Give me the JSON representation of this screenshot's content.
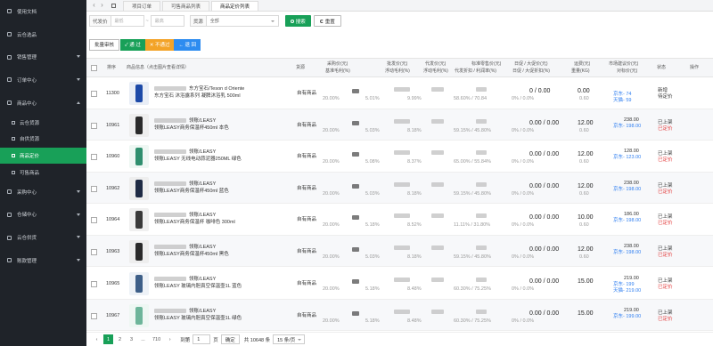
{
  "sidebar": {
    "items": [
      {
        "label": "使用文档",
        "icon": "doc-icon"
      },
      {
        "label": "云仓选品",
        "icon": "cloud-icon"
      },
      {
        "label": "销售管理",
        "icon": "sales-icon",
        "expandable": true
      },
      {
        "label": "订单中心",
        "icon": "order-icon",
        "expandable": true
      },
      {
        "label": "商品中心",
        "icon": "goods-icon",
        "expandable": true,
        "open": true
      },
      {
        "label": "云仓货源",
        "sub": true
      },
      {
        "label": "自供货源",
        "sub": true
      },
      {
        "label": "商品定价",
        "sub": true,
        "active": true
      },
      {
        "label": "可售商品",
        "sub": true
      },
      {
        "label": "采购中心",
        "icon": "purchase-icon",
        "expandable": true
      },
      {
        "label": "仓储中心",
        "icon": "warehouse-icon",
        "expandable": true
      },
      {
        "label": "云仓供货",
        "icon": "supply-icon",
        "expandable": true
      },
      {
        "label": "账款管理",
        "icon": "account-icon",
        "expandable": true
      }
    ]
  },
  "tabs": {
    "back": "‹",
    "forward": "›",
    "items": [
      {
        "label": "项目订单",
        "active": false
      },
      {
        "label": "可售商品列表",
        "active": false
      },
      {
        "label": "商品定价列表",
        "active": true
      }
    ]
  },
  "filters": {
    "code_label": "代发价",
    "min_placeholder": "最低",
    "sep": "~",
    "max_placeholder": "最高",
    "source_label": "货源",
    "source_value": "全部",
    "search_label": "搜索",
    "reset_label": "重置"
  },
  "actions": {
    "batch": "批量审核",
    "pass": "✓ 通 过",
    "reject": "✕ 不通过",
    "back": "← 退 回"
  },
  "table": {
    "headers": {
      "seq": "排序",
      "info": "商品信息（点击图片查看详情）",
      "source": "货源",
      "purchase": "采购价(元)",
      "purchase_sub": "基准毛利(%)",
      "wholesale": "批发价(元)",
      "wholesale_sub": "浮动毛利(%)",
      "dropship": "代发价(元)",
      "dropship_sub": "浮动毛利(%)",
      "retail": "标准零售价(元)",
      "retail_sub": "代发折扣 / 利润率(%)",
      "daily": "日促 / 大促价(元)",
      "daily_sub": "日促 / 大促折扣(%)",
      "freight": "运费(元)",
      "freight_sub": "重量(KG)",
      "market": "市场建议价(元)",
      "market_sub": "对标价(元)",
      "status": "状态",
      "ops": "操作"
    },
    "rows": [
      {
        "seq": "11300",
        "title1": "东方宝石/Teson d Oriente",
        "title2": "东方宝石 沐浴露系列 凝脾沐浴乳 500ml",
        "source": "自有商品",
        "m1": "20.00%",
        "m2": "5.01%",
        "m3": "9.99%",
        "retail_pct": "58.60% / 70.84",
        "daily": "0 / 0.00",
        "daily_pct": "0% / 0.0%",
        "freight": "0.00",
        "weight": "0.60",
        "market": "",
        "p1": "京东- 74",
        "p2": "天猫- 59",
        "status": "新增",
        "status2": "待定价",
        "thumb": "bottle-blue"
      },
      {
        "seq": "10961",
        "title1": "领账/LEASY",
        "title2": "领账LEASY商务保温杯450ml 本色",
        "source": "自有商品",
        "m1": "20.00%",
        "m2": "5.03%",
        "m3": "8.18%",
        "retail_pct": "59.15% / 45.80%",
        "daily": "0.00 / 0.00",
        "daily_pct": "0% / 0.0%",
        "freight": "12.00",
        "weight": "0.60",
        "market": "238.00",
        "p1": "京东- 198.00",
        "p2": "",
        "status": "已上架",
        "status2": "已定价",
        "thumb": "tumbler-black"
      },
      {
        "seq": "10960",
        "title1": "领账/LEASY",
        "title2": "领账LEASY 无线电动蒜泥器250ML 绿色",
        "source": "自有商品",
        "m1": "20.00%",
        "m2": "5.08%",
        "m3": "8.37%",
        "retail_pct": "65.00% / 55.84%",
        "daily": "0.00 / 0.00",
        "daily_pct": "0% / 0.0%",
        "freight": "12.00",
        "weight": "0.60",
        "market": "128.00",
        "p1": "京东- 123.00",
        "p2": "",
        "status": "已上架",
        "status2": "已定价",
        "thumb": "chopper-green"
      },
      {
        "seq": "10962",
        "title1": "领账/LEASY",
        "title2": "领账LEASY商务保温杯450ml 蓝色",
        "source": "自有商品",
        "m1": "20.00%",
        "m2": "5.03%",
        "m3": "8.18%",
        "retail_pct": "59.15% / 45.80%",
        "daily": "0.00 / 0.00",
        "daily_pct": "0% / 0.0%",
        "freight": "12.00",
        "weight": "0.60",
        "market": "238.00",
        "p1": "京东- 198.00",
        "p2": "",
        "status": "已上架",
        "status2": "已定价",
        "thumb": "tumbler-navy"
      },
      {
        "seq": "10964",
        "title1": "领账/LEASY",
        "title2": "领账LEASY商务保温杯 咖啡色 300ml",
        "source": "自有商品",
        "m1": "20.00%",
        "m2": "5.18%",
        "m3": "8.52%",
        "retail_pct": "11.11% / 31.80%",
        "daily": "0.00 / 0.00",
        "daily_pct": "0% / 0.0%",
        "freight": "10.00",
        "weight": "0.60",
        "market": "186.00",
        "p1": "京东- 198.00",
        "p2": "",
        "status": "已上架",
        "status2": "已定价",
        "thumb": "cup-set"
      },
      {
        "seq": "10963",
        "title1": "领账/LEASY",
        "title2": "领账LEASY商务保温杯450ml 黑色",
        "source": "自有商品",
        "m1": "20.00%",
        "m2": "5.03%",
        "m3": "8.18%",
        "retail_pct": "59.15% / 45.80%",
        "daily": "0.00 / 0.00",
        "daily_pct": "0% / 0.0%",
        "freight": "12.00",
        "weight": "0.60",
        "market": "238.00",
        "p1": "京东- 198.00",
        "p2": "",
        "status": "已上架",
        "status2": "已定价",
        "thumb": "tumbler-black"
      },
      {
        "seq": "10965",
        "title1": "领账/LEASY",
        "title2": "领账LEASY 玻璃内胆真空保温壶1L 蓝色",
        "source": "自有商品",
        "m1": "20.00%",
        "m2": "5.18%",
        "m3": "8.48%",
        "retail_pct": "60.30% / 75.25%",
        "daily": "0.00 / 0.00",
        "daily_pct": "0% / 0.0%",
        "freight": "15.00",
        "weight": "",
        "market": "219.00",
        "p1": "京东- 199",
        "p2": "天猫- 219.00",
        "status": "已上架",
        "status2": "已定价",
        "thumb": "kettle-blue"
      },
      {
        "seq": "10967",
        "title1": "领账/LEASY",
        "title2": "领账LEASY 玻璃内胆真空保温壶1L 绿色",
        "source": "自有商品",
        "m1": "20.00%",
        "m2": "5.18%",
        "m3": "8.48%",
        "retail_pct": "60.30% / 75.25%",
        "daily": "0.00 / 0.00",
        "daily_pct": "0% / 0.0%",
        "freight": "15.00",
        "weight": "",
        "market": "219.00",
        "p1": "京东- 199.00",
        "p2": "",
        "status": "已上架",
        "status2": "已定价",
        "thumb": "kettle-green"
      }
    ]
  },
  "pager": {
    "pages": [
      "1",
      "2",
      "3",
      "...",
      "710"
    ],
    "goto_label": "到第",
    "goto_value": "1",
    "page_unit": "页",
    "confirm": "确定",
    "total": "共 10648 条",
    "size": "15 条/页"
  },
  "colors": {
    "accent": "#18a058",
    "sidebar": "#1f2329",
    "warn": "#f3a327",
    "info": "#2d8cf0"
  }
}
